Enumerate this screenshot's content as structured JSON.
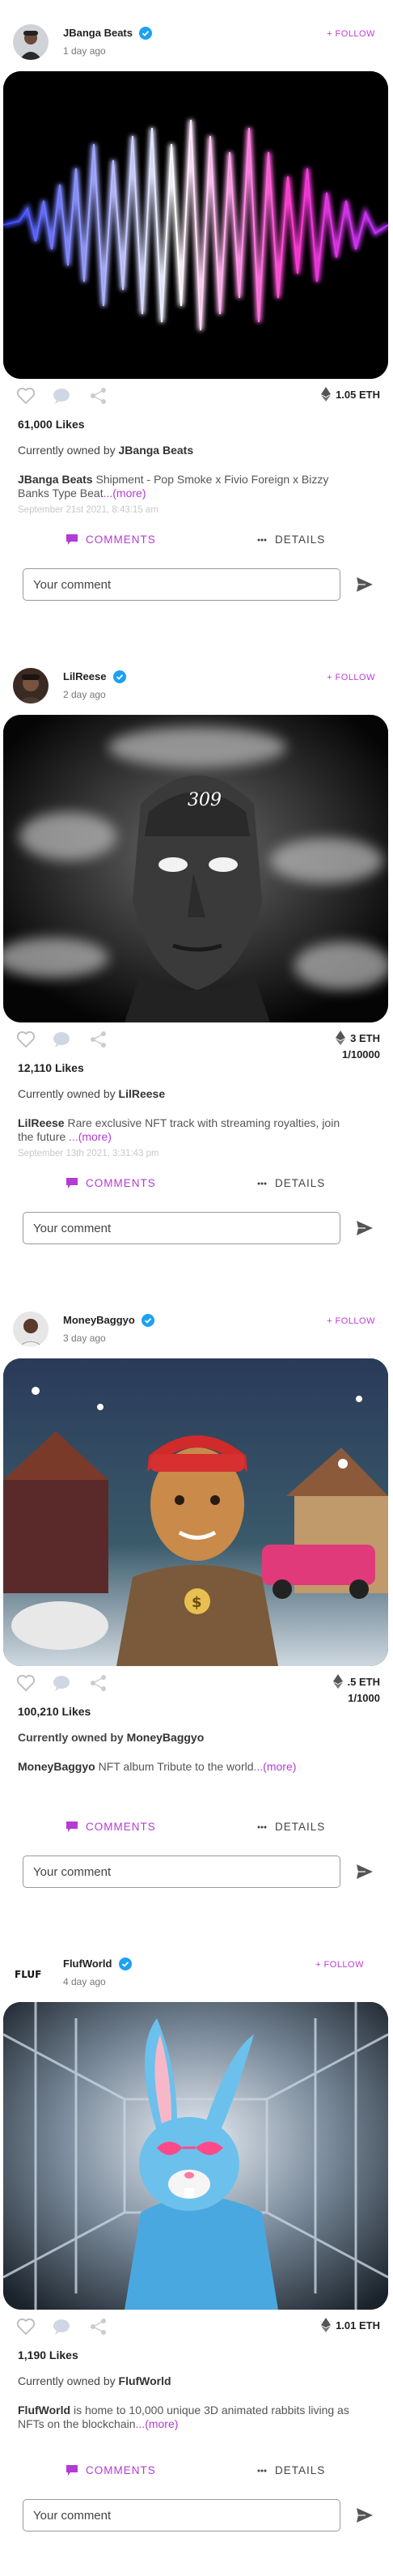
{
  "posts": [
    {
      "username": "JBanga Beats",
      "time_ago": "1 day ago",
      "follow_label": "+ FOLLOW",
      "image_icon": "waveform-artwork",
      "price": "1.05 ETH",
      "edition": "",
      "likes": "61,000 Likes",
      "owner_prefix": "Currently owned by",
      "owner": "JBanga Beats",
      "caption_user": "JBanga Beats",
      "caption_text": " Shipment - Pop Smoke x Fivio Foreign x Bizzy Banks Type Beat",
      "more_label": "...(more)",
      "date": "September 21st 2021, 8:43:15 am",
      "comments_label": "COMMENTS",
      "details_label": "DETAILS",
      "comment_placeholder": "Your comment"
    },
    {
      "username": "LilReese",
      "time_ago": "2 day ago",
      "follow_label": "+ FOLLOW",
      "image_icon": "smoke-portrait-artwork",
      "price": "3 ETH",
      "edition": "1/10000",
      "likes": "12,110 Likes",
      "owner_prefix": "Currently owned by",
      "owner": "LilReese",
      "caption_user": "LilReese",
      "caption_text": " Rare exclusive NFT track with streaming royalties, join the future ",
      "more_label": "...(more)",
      "date": "September 13th 2021, 3:31:43 pm",
      "comments_label": "COMMENTS",
      "details_label": "DETAILS",
      "comment_placeholder": "Your comment"
    },
    {
      "username": "MoneyBaggyo",
      "time_ago": "3 day ago",
      "follow_label": "+ FOLLOW",
      "image_icon": "cartoon-album-artwork",
      "price": ".5 ETH",
      "edition": "1/1000",
      "likes": "100,210 Likes",
      "owner_prefix": "Currently owned by",
      "owner": "MoneyBaggyo",
      "caption_user": "MoneyBaggyo",
      "caption_text": " NFT album Tribute to the world",
      "more_label": "...(more)",
      "date": "",
      "comments_label": "COMMENTS",
      "details_label": "DETAILS",
      "comment_placeholder": "Your comment"
    },
    {
      "username": "FlufWorld",
      "time_ago": "4 day ago",
      "follow_label": "+ FOLLOW",
      "avatar_text": "FLUF",
      "image_icon": "3d-rabbit-artwork",
      "price": "1.01 ETH",
      "edition": "",
      "likes": "1,190 Likes",
      "owner_prefix": "Currently owned by",
      "owner": "FlufWorld",
      "caption_user": "FlufWorld",
      "caption_text": " is home to 10,000 unique 3D animated rabbits living as NFTs on the blockchain",
      "more_label": "...(more)",
      "date": "",
      "comments_label": "COMMENTS",
      "details_label": "DETAILS",
      "comment_placeholder": "Your comment"
    }
  ],
  "colors": {
    "accent": "#b43bd4",
    "verified": "#1da1f2"
  }
}
